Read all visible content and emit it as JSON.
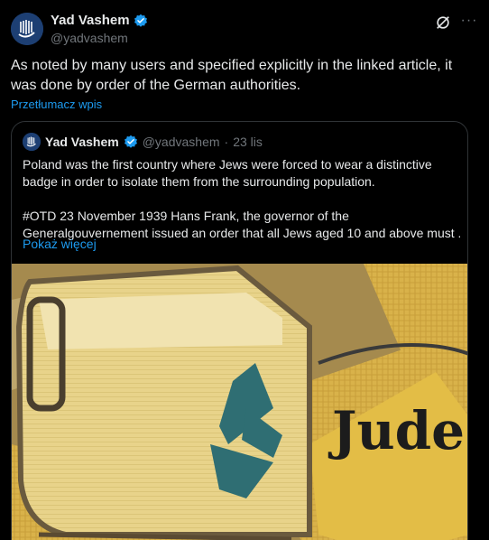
{
  "post": {
    "display_name": "Yad Vashem",
    "handle": "@yadvashem",
    "text": "As noted by many users and specified explicitly in the linked article, it was done by order of the German authorities.",
    "translate_label": "Przetłumacz wpis"
  },
  "quote": {
    "display_name": "Yad Vashem",
    "handle": "@yadvashem",
    "separator": "·",
    "date": "23 lis",
    "line1": "Poland was the first country where Jews were forced to wear a distinctive",
    "line2": "badge in order to isolate them from the surrounding population.",
    "line3": "#OTD 23 November 1939 Hans Frank, the governor of the",
    "line4": "Generalgouvernement issued an order that all Jews aged 10 and above must ...",
    "show_more_label": "Pokaż więcej",
    "image_text": "Jude"
  },
  "icons": {
    "verified": "verified-badge-icon",
    "grok": "grok-icon",
    "more": "more-icon"
  },
  "colors": {
    "background": "#000000",
    "text": "#e7e9ea",
    "muted": "#71767b",
    "link": "#1d9bf0",
    "border": "#2f3336"
  }
}
